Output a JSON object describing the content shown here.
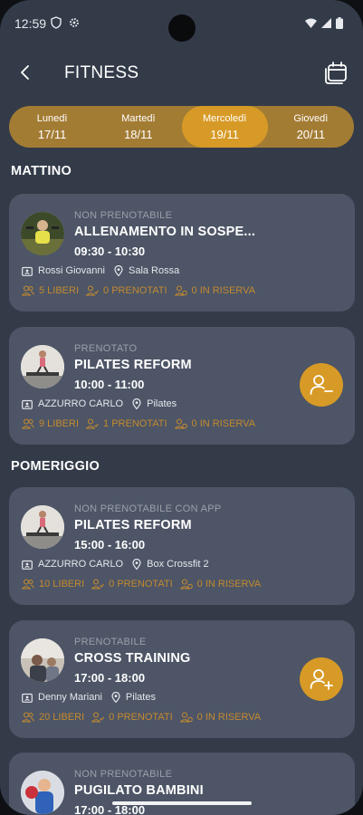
{
  "status_bar": {
    "time": "12:59"
  },
  "header": {
    "title": "FITNESS"
  },
  "days": [
    {
      "name": "Lunedì",
      "date": "17/11"
    },
    {
      "name": "Martedì",
      "date": "18/11"
    },
    {
      "name": "Mercoledì",
      "date": "19/11",
      "active": true
    },
    {
      "name": "Giovedì",
      "date": "20/11"
    }
  ],
  "sections": {
    "morning": "MATTINO",
    "afternoon": "POMERIGGIO"
  },
  "classes": [
    {
      "status": "NON PRENOTABILE",
      "title": "ALLENAMENTO IN SOSPE...",
      "time": "09:30 - 10:30",
      "instructor": "Rossi Giovanni",
      "room": "Sala Rossa",
      "free": "5 LIBERI",
      "booked": "0 PRENOTATI",
      "reserve": "0 IN RISERVA",
      "action": "none"
    },
    {
      "status": "PRENOTATO",
      "title": "PILATES REFORM",
      "time": "10:00 - 11:00",
      "instructor": "AZZURRO CARLO",
      "room": "Pilates",
      "free": "9 LIBERI",
      "booked": "1 PRENOTATI",
      "reserve": "0 IN RISERVA",
      "action": "remove-user-icon"
    },
    {
      "status": "NON PRENOTABILE CON APP",
      "title": "PILATES REFORM",
      "time": "15:00 - 16:00",
      "instructor": "AZZURRO CARLO",
      "room": "Box Crossfit 2",
      "free": "10 LIBERI",
      "booked": "0 PRENOTATI",
      "reserve": "0 IN RISERVA",
      "action": "none"
    },
    {
      "status": "PRENOTABILE",
      "title": "CROSS TRAINING",
      "time": "17:00 - 18:00",
      "instructor": "Denny Mariani",
      "room": "Pilates",
      "free": "20 LIBERI",
      "booked": "0 PRENOTATI",
      "reserve": "0 IN RISERVA",
      "action": "add-user-icon"
    },
    {
      "status": "NON PRENOTABILE",
      "title": "PUGILATO BAMBINI",
      "time": "17:00 - 18:00"
    }
  ],
  "colors": {
    "accent": "#d79a26",
    "accent_dark": "#a37c34",
    "card": "#4d5566",
    "background": "#333b49"
  }
}
